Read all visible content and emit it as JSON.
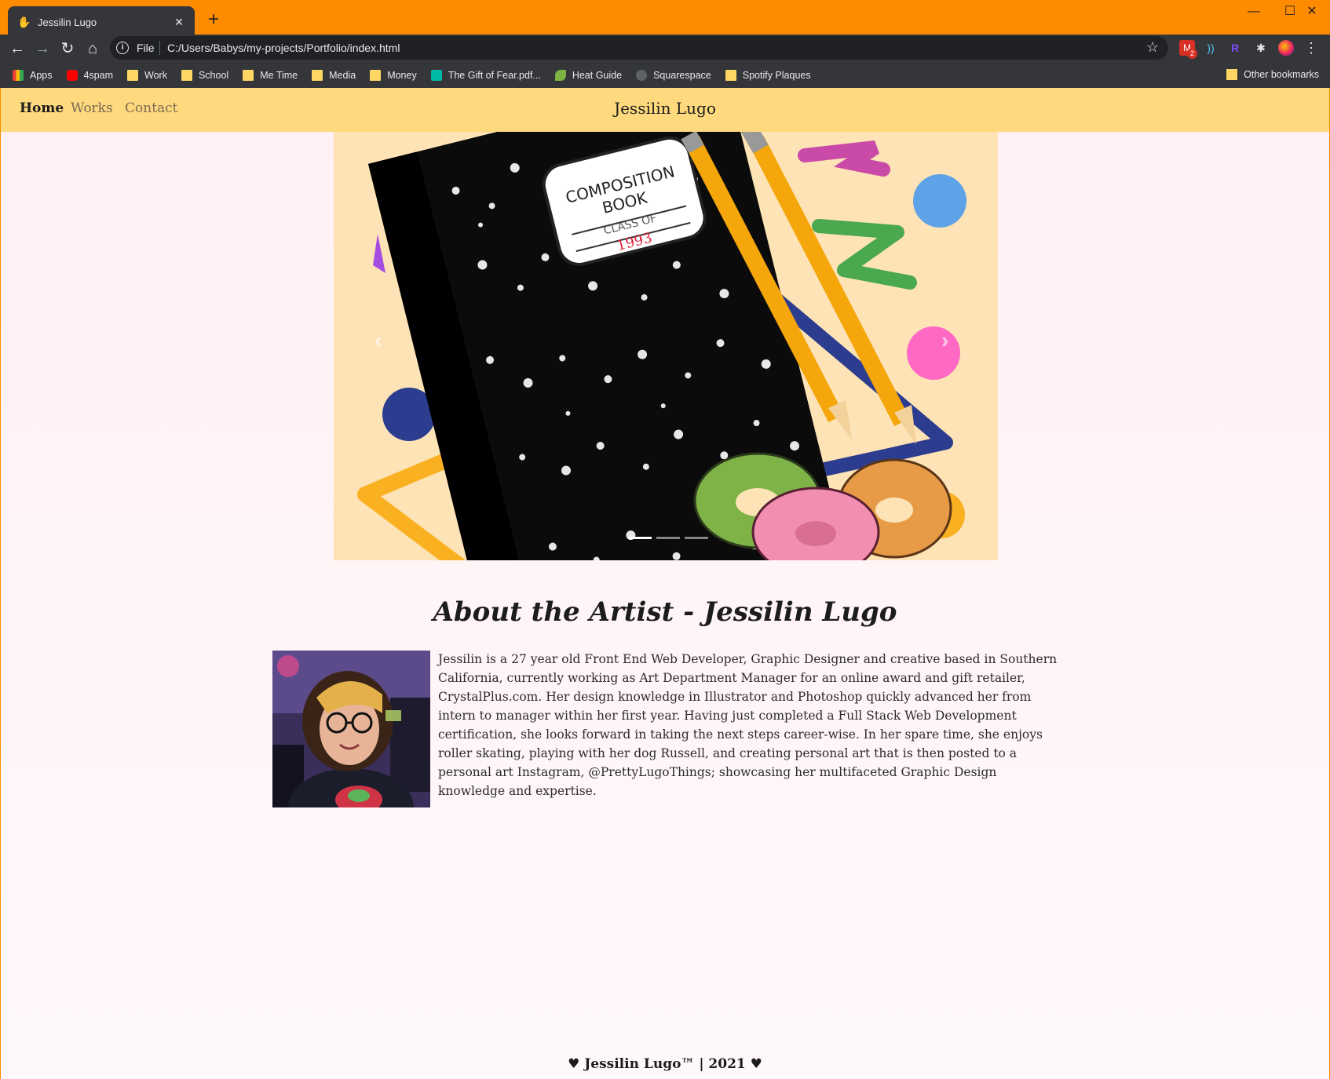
{
  "browser": {
    "tab_title": "Jessilin Lugo",
    "tab_close": "✕",
    "new_tab": "+",
    "window_controls": {
      "minimize": "—",
      "maximize": "☐",
      "close": "✕"
    },
    "nav": {
      "back": "←",
      "forward": "→",
      "reload": "↻",
      "home": "⌂"
    },
    "omnibox": {
      "scheme_label": "File",
      "url": "C:/Users/Babys/my-projects/Portfolio/index.html",
      "star": "☆",
      "info": "i"
    },
    "extensions": {
      "gmail_badge": "2",
      "gmail": "M",
      "r": "R",
      "puzzle": "✱",
      "menu": "⋮",
      "wave": "))"
    },
    "bookmarks": [
      {
        "label": "Apps",
        "icon": "apps-icon"
      },
      {
        "label": "4spam",
        "icon": "youtube-icon"
      },
      {
        "label": "Work",
        "icon": "folder-icon"
      },
      {
        "label": "School",
        "icon": "folder-icon"
      },
      {
        "label": "Me Time",
        "icon": "folder-icon"
      },
      {
        "label": "Media",
        "icon": "folder-icon"
      },
      {
        "label": "Money",
        "icon": "folder-icon"
      },
      {
        "label": "The Gift of Fear.pdf...",
        "icon": "document-icon"
      },
      {
        "label": "Heat Guide",
        "icon": "leaf-icon"
      },
      {
        "label": "Squarespace",
        "icon": "squarespace-icon"
      },
      {
        "label": "Spotify Plaques",
        "icon": "folder-icon"
      }
    ],
    "other_bookmarks": "Other bookmarks"
  },
  "site": {
    "nav": {
      "home": "Home",
      "works": "Works",
      "contact": "Contact"
    },
    "brand": "Jessilin Lugo",
    "carousel": {
      "prev": "‹",
      "next": "›",
      "label_line1": "COMPOSITION",
      "label_line2": "BOOK",
      "label_class": "CLASS OF",
      "label_year": "1993",
      "active_slide": 1,
      "slide_count": 3
    },
    "about_title": "About the Artist - Jessilin Lugo",
    "about_text": "Jessilin is a 27 year old Front End Web Developer, Graphic Designer and creative based in Southern California, currently working as Art Department Manager for an online award and gift retailer, CrystalPlus.com. Her design knowledge in Illustrator and Photoshop quickly advanced her from intern to manager within her first year. Having just completed a Full Stack Web Development certification, she looks forward in taking the next steps career-wise. In her spare time, she enjoys roller skating, playing with her dog Russell, and creating personal art that is then posted to a personal art Instagram, @PrettyLugoThings; showcasing her multifaceted Graphic Design knowledge and expertise.",
    "footer": "♥ Jessilin Lugo™ | 2021 ♥"
  },
  "colors": {
    "chrome_frame": "#ff8c00",
    "toolbar": "#35363a",
    "site_nav": "#ffd97d",
    "page_bg": "#fff0f3",
    "carousel_bg": "#fde3b6"
  }
}
